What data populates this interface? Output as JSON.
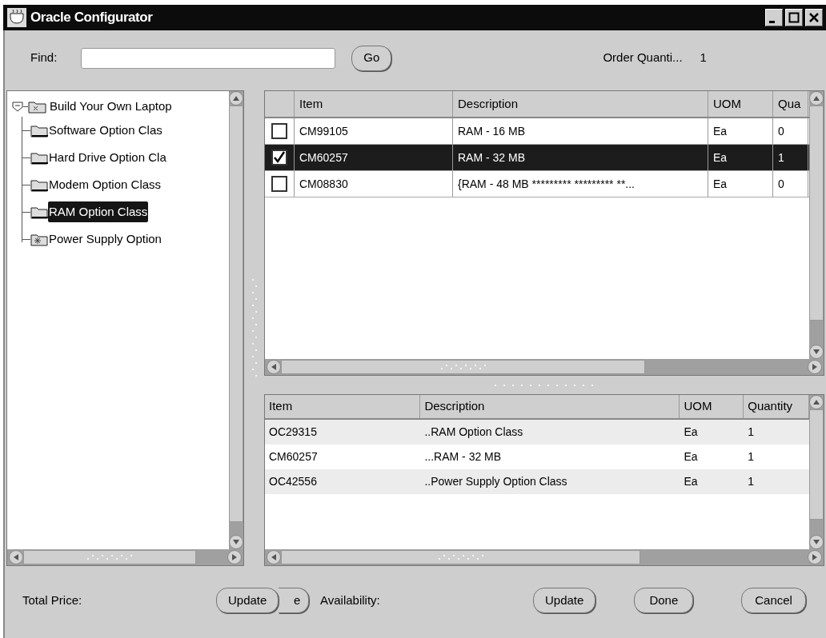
{
  "window": {
    "title": "Oracle Configurator"
  },
  "find": {
    "label": "Find:",
    "button": "Go"
  },
  "order_quantity": {
    "label": "Order Quanti...",
    "value": "1"
  },
  "tree": {
    "label": "Build Your Own Laptop",
    "expanded": true,
    "selected": false,
    "children": [
      {
        "label": "Software Option Clas",
        "kind": "folder",
        "selected": false
      },
      {
        "label": "Hard Drive Option Cla",
        "kind": "folder",
        "selected": false
      },
      {
        "label": "Modem Option Class",
        "kind": "folder",
        "selected": false
      },
      {
        "label": "RAM Option Class",
        "kind": "folder",
        "selected": true
      },
      {
        "label": "Power Supply Option",
        "kind": "special",
        "selected": false
      }
    ]
  },
  "options_table": {
    "columns": [
      "Item",
      "Description",
      "UOM",
      "Qua"
    ],
    "rows": [
      {
        "checked": false,
        "selected": false,
        "cells": [
          "CM99105",
          "RAM - 16 MB",
          "Ea",
          "0"
        ]
      },
      {
        "checked": true,
        "selected": true,
        "cells": [
          "CM60257",
          "RAM - 32 MB",
          "Ea",
          "1"
        ]
      },
      {
        "checked": false,
        "selected": false,
        "cells": [
          "CM08830",
          "{RAM - 48 MB ********* ********* **...",
          "Ea",
          "0"
        ]
      }
    ]
  },
  "selection_table": {
    "columns": [
      "Item",
      "Description",
      "UOM",
      "Quantity"
    ],
    "rows": [
      {
        "cells": [
          "OC29315",
          "..RAM Option Class",
          "Ea",
          "1"
        ]
      },
      {
        "cells": [
          "CM60257",
          "...RAM - 32 MB",
          "Ea",
          "1"
        ]
      },
      {
        "cells": [
          "OC42556",
          "..Power Supply Option Class",
          "Ea",
          "1"
        ]
      }
    ]
  },
  "footer": {
    "total_price_label": "Total Price:",
    "price_buttons": [
      "Update",
      "e"
    ],
    "availability_label": "Availability:",
    "buttons": [
      "Update",
      "Done",
      "Cancel"
    ]
  }
}
